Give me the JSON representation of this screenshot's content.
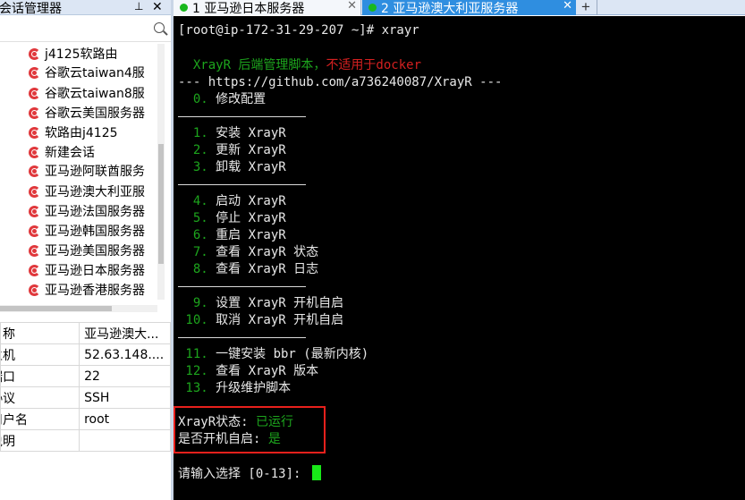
{
  "sidebar": {
    "title": "会话管理器",
    "search": {
      "value": "",
      "placeholder": ""
    },
    "items": [
      {
        "label": "j4125软路由"
      },
      {
        "label": "谷歌云taiwan4服"
      },
      {
        "label": "谷歌云taiwan8服"
      },
      {
        "label": "谷歌云美国服务器"
      },
      {
        "label": "软路由j4125"
      },
      {
        "label": "新建会话"
      },
      {
        "label": "亚马逊阿联酋服务"
      },
      {
        "label": "亚马逊澳大利亚服"
      },
      {
        "label": "亚马逊法国服务器"
      },
      {
        "label": "亚马逊韩国服务器"
      },
      {
        "label": "亚马逊美国服务器"
      },
      {
        "label": "亚马逊日本服务器"
      },
      {
        "label": "亚马逊香港服务器"
      }
    ],
    "properties": [
      {
        "key": "名称",
        "value": "亚马逊澳大..."
      },
      {
        "key": "主机",
        "value": "52.63.148...."
      },
      {
        "key": "端口",
        "value": "22"
      },
      {
        "key": "协议",
        "value": "SSH"
      },
      {
        "key": "用户名",
        "value": "root"
      },
      {
        "key": "说明",
        "value": ""
      }
    ]
  },
  "tabs": [
    {
      "label": "1 亚马逊日本服务器",
      "active": false,
      "status_color": "#19b81d"
    },
    {
      "label": "2 亚马逊澳大利亚服务器",
      "active": true,
      "status_color": "#19b81d"
    }
  ],
  "icons": {
    "pin": "pin-icon",
    "close": "close-icon",
    "search": "search-icon",
    "session": "session-icon",
    "add_tab": "add-tab-icon"
  },
  "symbols": {
    "pin": "⊥",
    "close": "✕",
    "tab_close": "✕",
    "add_tab": "+"
  },
  "terminal": {
    "prompt": "[root@ip-172-31-29-207 ~]# xrayr",
    "header_green": "  XrayR 后端管理脚本，",
    "header_red": "不适用于docker",
    "url_line": "--- https://github.com/a736240087/XrayR ---",
    "menu": [
      {
        "num": "  0.",
        "text": " 修改配置"
      },
      {
        "num": "  1.",
        "text": " 安装 XrayR"
      },
      {
        "num": "  2.",
        "text": " 更新 XrayR"
      },
      {
        "num": "  3.",
        "text": " 卸载 XrayR"
      },
      {
        "num": "  4.",
        "text": " 启动 XrayR"
      },
      {
        "num": "  5.",
        "text": " 停止 XrayR"
      },
      {
        "num": "  6.",
        "text": " 重启 XrayR"
      },
      {
        "num": "  7.",
        "text": " 查看 XrayR 状态"
      },
      {
        "num": "  8.",
        "text": " 查看 XrayR 日志"
      },
      {
        "num": "  9.",
        "text": " 设置 XrayR 开机自启"
      },
      {
        "num": " 10.",
        "text": " 取消 XrayR 开机自启"
      },
      {
        "num": " 11.",
        "text": " 一键安装 bbr (最新内核)"
      },
      {
        "num": " 12.",
        "text": " 查看 XrayR 版本"
      },
      {
        "num": " 13.",
        "text": " 升级维护脚本"
      }
    ],
    "status_label": "XrayR状态: ",
    "status_value": "已运行",
    "autostart_label": "是否开机自启: ",
    "autostart_value": "是",
    "input_prompt": "请输入选择 [0-13]: "
  },
  "colors": {
    "terminal_bg": "#000000",
    "terminal_green": "#1da51d",
    "terminal_red": "#d42020",
    "active_tab": "#2f8ee0",
    "highlight_box": "#e8201c",
    "cursor": "#18e818",
    "session_icon": "#e0383c"
  }
}
